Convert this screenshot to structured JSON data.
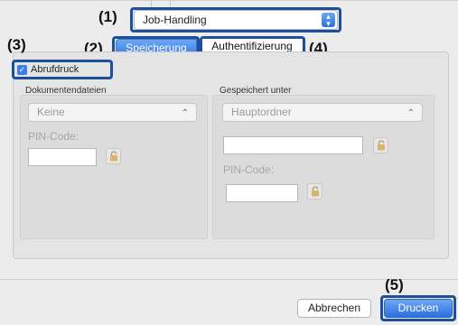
{
  "callouts": {
    "c1": "(1)",
    "c2": "(2)",
    "c3": "(3)",
    "c4": "(4)",
    "c5": "(5)"
  },
  "popup": {
    "value": "Job-Handling",
    "icon": "stepper-arrows-icon"
  },
  "tabs": [
    {
      "label": "Speicherung",
      "selected": true
    },
    {
      "label": "Authentifizierung",
      "selected": false
    }
  ],
  "checkbox": {
    "label": "Abrufdruck",
    "checked": true
  },
  "left_section": {
    "title": "Dokumentendateien",
    "select_value": "Keine",
    "pin_label": "PIN-Code:"
  },
  "right_section": {
    "title": "Gespeichert unter",
    "select_value": "Hauptordner",
    "pin_label": "PIN-Code:"
  },
  "buttons": {
    "cancel": "Abbrechen",
    "print": "Drucken"
  },
  "colors": {
    "highlight": "#1d4f9a",
    "accent": "#3a7ee6"
  }
}
